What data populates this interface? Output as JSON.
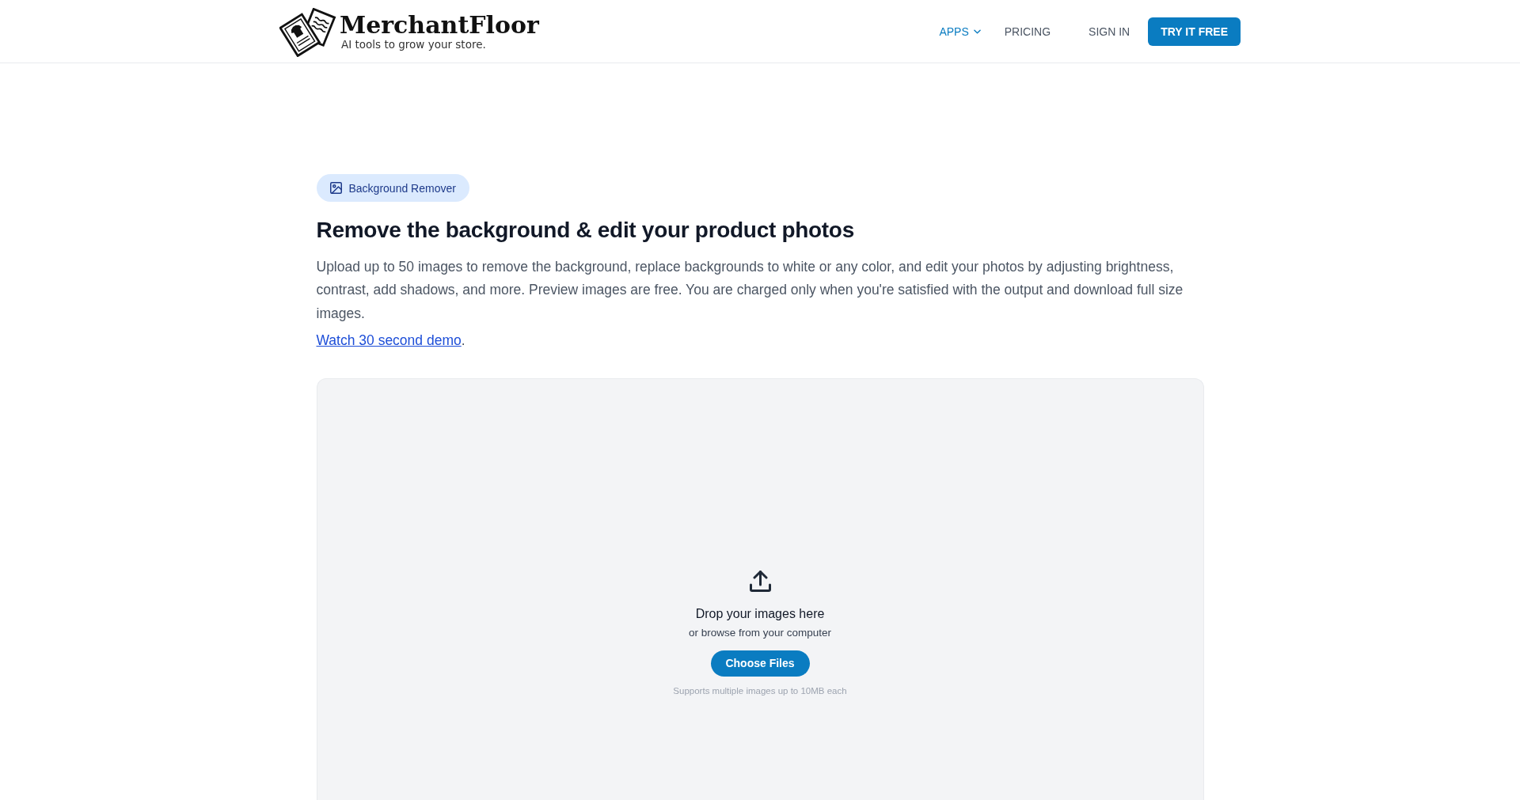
{
  "header": {
    "logo": {
      "name": "MerchantFloor",
      "tagline": "AI tools to grow your store."
    },
    "nav": [
      {
        "label": "APPS",
        "kind": "dropdown",
        "selected": true
      },
      {
        "label": "PRICING",
        "kind": "link",
        "selected": false
      }
    ],
    "sign_in": "SIGN IN",
    "cta": "TRY IT FREE"
  },
  "intro": {
    "tag": "Background Remover",
    "title": "Remove the background & edit your product photos",
    "description": "Upload up to 50 images to remove the background, replace backgrounds to white or any color, and edit your photos by adjusting brightness, contrast, add shadows, and more. Preview images are free. You are charged only when you're satisfied with the output and download full size images.",
    "demo": {
      "link": "Watch 30 second demo",
      "after": "."
    }
  },
  "upload": {
    "title": "Drop your images here",
    "subtitle": "or browse from your computer",
    "button": "Choose Files",
    "note": "Supports multiple images up to 10MB each"
  }
}
